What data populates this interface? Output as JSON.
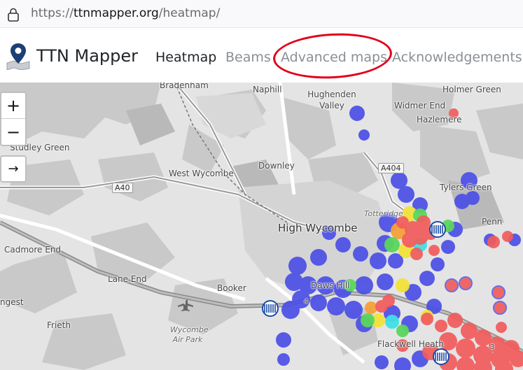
{
  "browser": {
    "url_prefix": "https://",
    "url_host": "ttnmapper.org",
    "url_path": "/heatmap/"
  },
  "navbar": {
    "brand": "TTN Mapper",
    "links": [
      {
        "label": "Heatmap",
        "active": true
      },
      {
        "label": "Beams",
        "active": false
      },
      {
        "label": "Advanced maps",
        "active": false,
        "circled": true
      },
      {
        "label": "Acknowledgements",
        "active": false
      }
    ]
  },
  "map_controls": {
    "zoom_in": "+",
    "zoom_out": "−",
    "locate": "→"
  },
  "map": {
    "places": [
      "Bradenham",
      "Naphill",
      "Hughenden Valley",
      "Holmer Green",
      "Widmer End",
      "Hazlemere",
      "Studley Green",
      "West Wycombe",
      "Downley",
      "Tylers Green",
      "Penn",
      "Totteridge",
      "High Wycombe",
      "Cadmore End",
      "Lane End",
      "Booker",
      "Daws Hill",
      "Frieth",
      "Wycombe Air Park",
      "Flackwell Heath",
      "ngest"
    ],
    "roads": [
      "A40",
      "A404",
      "4",
      "3"
    ]
  },
  "colors": {
    "annotation": "#e0001a",
    "heat_blue": "#4b4fe6",
    "heat_red": "#f25c5c",
    "heat_green": "#5cd65c",
    "heat_yellow": "#f2e23a",
    "heat_cyan": "#3fe0e6",
    "heat_orange": "#f5a13a"
  }
}
